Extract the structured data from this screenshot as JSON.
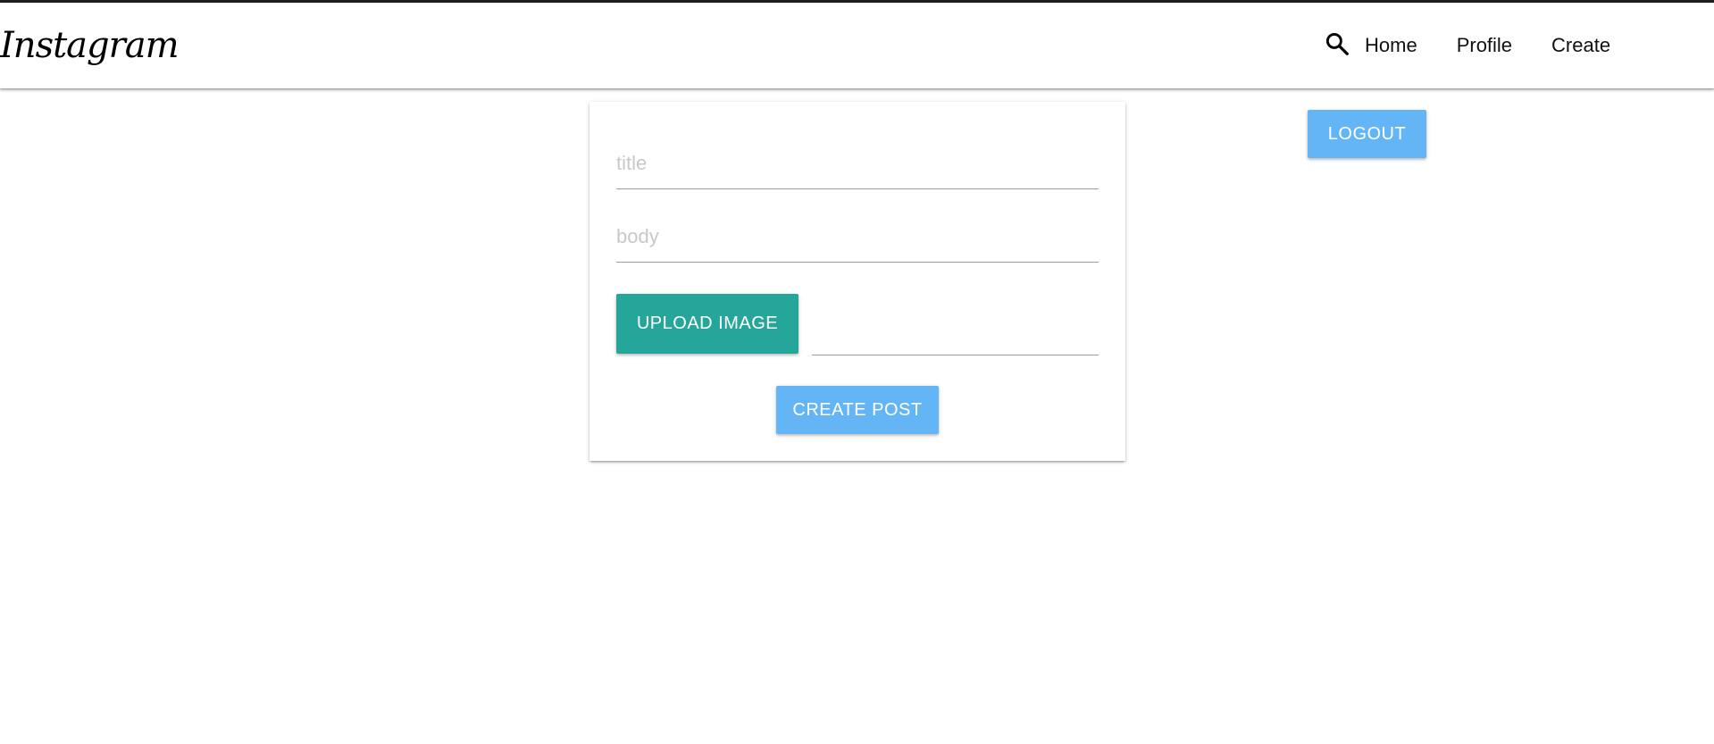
{
  "navbar": {
    "brand": "Instagram",
    "search_icon": "search-icon",
    "links": [
      "Home",
      "Profile",
      "Create"
    ]
  },
  "logout": {
    "label": "LOGOUT"
  },
  "create_post_form": {
    "title_placeholder": "title",
    "body_placeholder": "body",
    "upload_label": "UPLOAD IMAGE",
    "file_path_value": "",
    "submit_label": "CREATE POST"
  },
  "colors": {
    "upload_button": "#26a69a",
    "primary_button": "#64b5f6",
    "top_border": "#1f1f1f"
  }
}
